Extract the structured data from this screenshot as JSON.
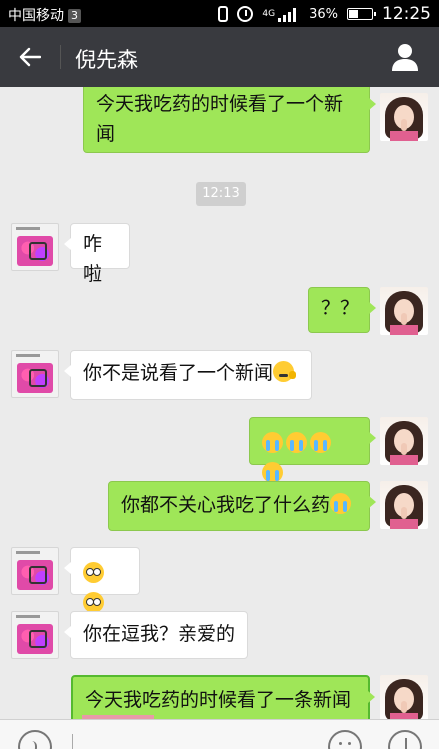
{
  "status_bar": {
    "carrier": "中国移动",
    "sim_slot": "3",
    "network": "4G",
    "battery": "36%",
    "battery_level": 0.36,
    "time": "12:25"
  },
  "header": {
    "title": "倪先森"
  },
  "chat": {
    "timestamp": "12:13",
    "messages": [
      {
        "side": "out",
        "text": "今天我吃药的时候看了一个新闻"
      },
      {
        "side": "in",
        "text": "咋啦"
      },
      {
        "side": "out",
        "text": "？？"
      },
      {
        "side": "in",
        "text": "你不是说看了一个新闻",
        "emoji": [
          "think"
        ]
      },
      {
        "side": "out",
        "text": "",
        "emoji": [
          "cry",
          "cry",
          "cry",
          "cry"
        ]
      },
      {
        "side": "out",
        "text": "你都不关心我吃了什么药",
        "emoji": [
          "cry"
        ]
      },
      {
        "side": "in",
        "text": "",
        "emoji": [
          "shock",
          "shock"
        ]
      },
      {
        "side": "in",
        "text": "你在逗我？亲爱的"
      },
      {
        "side": "out",
        "text": "今天我吃药的时候看了一条新闻",
        "highlighted": true
      }
    ]
  },
  "input_bar": {
    "value": ""
  }
}
